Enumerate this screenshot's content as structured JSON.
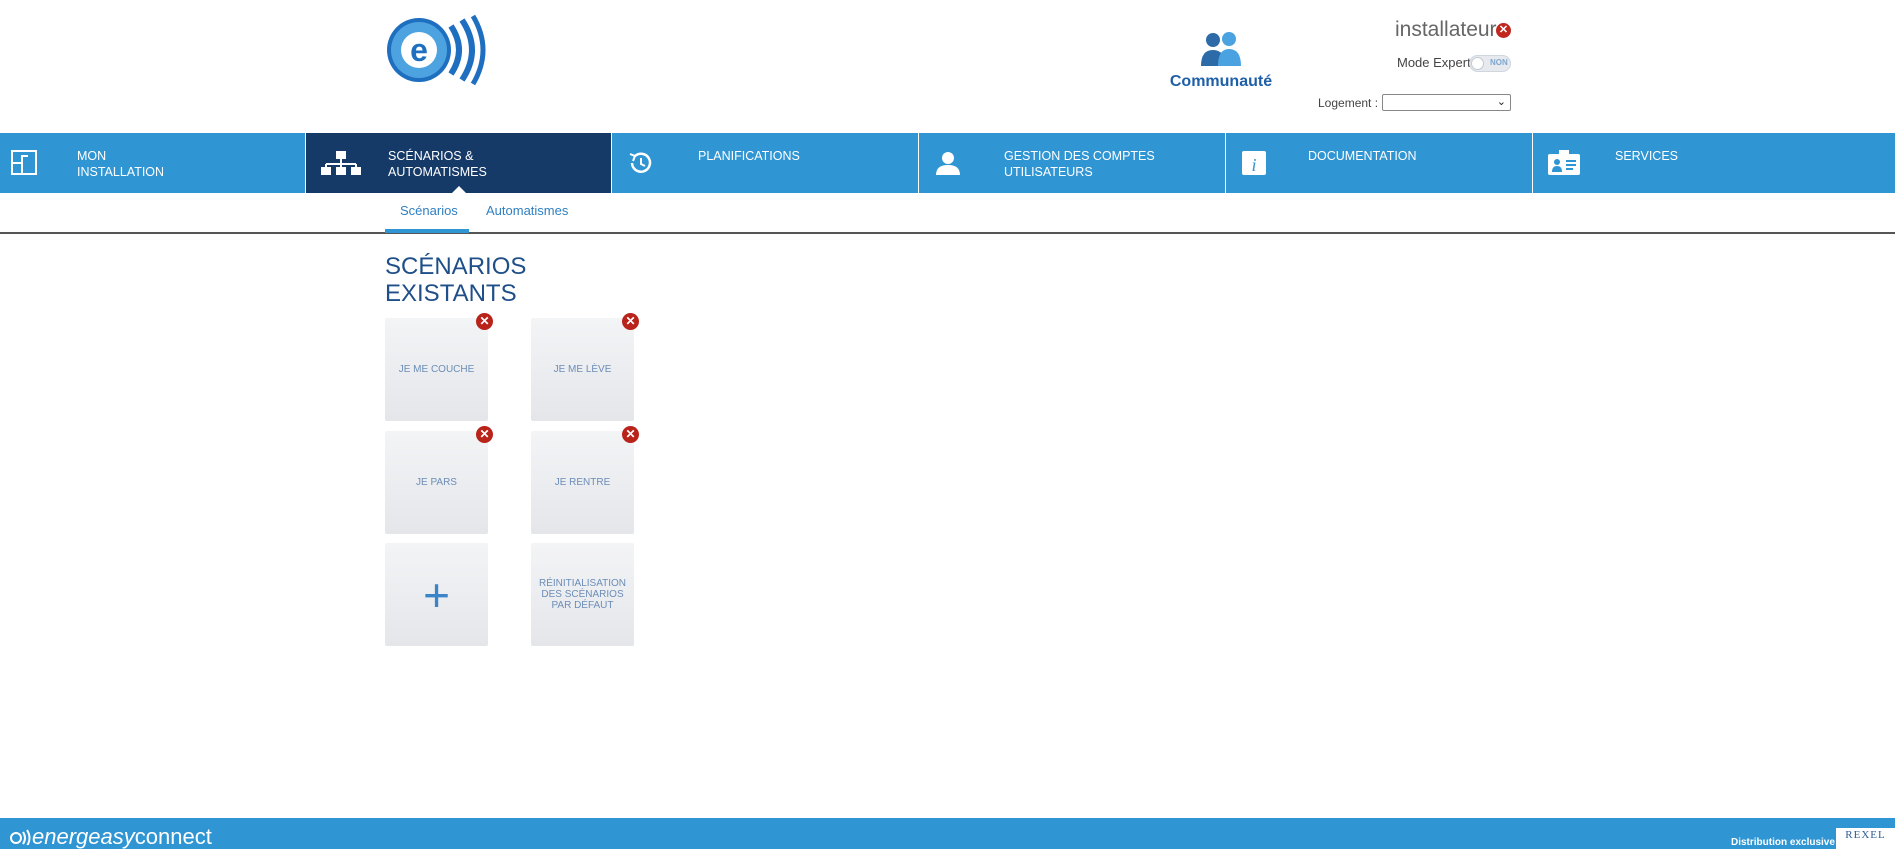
{
  "header": {
    "community_label": "Communauté",
    "user_name": "installateur",
    "mode_expert_label": "Mode Expert",
    "mode_expert_state": "NON",
    "logement_label": "Logement :",
    "logement_value": ""
  },
  "nav": {
    "items": [
      {
        "label": "MON\nINSTALLATION",
        "icon": "installation-icon",
        "active": false
      },
      {
        "label": "SCÉNARIOS &\nAUTOMATISMES",
        "icon": "scenarios-icon",
        "active": true
      },
      {
        "label": "PLANIFICATIONS",
        "icon": "history-icon",
        "active": false
      },
      {
        "label": "GESTION DES COMPTES\nUTILISATEURS",
        "icon": "user-icon",
        "active": false
      },
      {
        "label": "DOCUMENTATION",
        "icon": "info-icon",
        "active": false
      },
      {
        "label": "SERVICES",
        "icon": "services-icon",
        "active": false
      }
    ]
  },
  "subnav": {
    "tabs": [
      {
        "label": "Scénarios",
        "active": true
      },
      {
        "label": "Automatismes",
        "active": false
      }
    ]
  },
  "main": {
    "title": "SCÉNARIOS\nEXISTANTS",
    "tiles": [
      {
        "label": "JE ME COUCHE",
        "deletable": true
      },
      {
        "label": "JE ME LÈVE",
        "deletable": true
      },
      {
        "label": "JE PARS",
        "deletable": true
      },
      {
        "label": "JE RENTRE",
        "deletable": true
      },
      {
        "label": "+",
        "deletable": false
      },
      {
        "label": "RÉINITIALISATION DES SCÉNARIOS PAR DÉFAUT",
        "deletable": false
      }
    ]
  },
  "footer": {
    "brand_light": "energeasy",
    "brand_bold": "connect",
    "distribution": "Distribution exclusive",
    "partner": "REXEL"
  },
  "colors": {
    "nav_bg": "#2f95d3",
    "nav_active": "#163a67",
    "title": "#1f4f88",
    "delete": "#b8231a"
  }
}
